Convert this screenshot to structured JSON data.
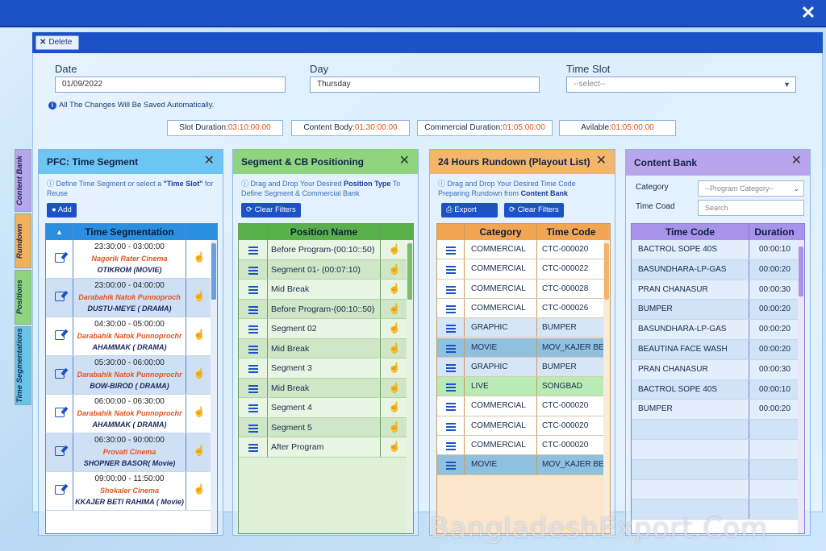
{
  "window": {
    "close_icon": "close-x-icon"
  },
  "toolbar": {
    "delete_label": "Delete"
  },
  "form": {
    "date_label": "Date",
    "date_value": "01/09/2022",
    "day_label": "Day",
    "day_value": "Thursday",
    "timeslot_label": "Time Slot",
    "timeslot_value": "--select--"
  },
  "note": "All The Changes Will Be Saved Automatically.",
  "stats": [
    {
      "label": "Slot Duration:",
      "value": "03:10:00:00"
    },
    {
      "label": "Content Body:",
      "value": "01:30:00:00"
    },
    {
      "label": "Commercial Duration:",
      "value": "01:05:00:00"
    },
    {
      "label": "Avilable:",
      "value": "01:05:00:00"
    }
  ],
  "side_tabs": [
    "Content Bank",
    "Rundown",
    "Positions",
    "Time Segmentations"
  ],
  "pfc": {
    "title": "PFC: Time Segment",
    "desc_pre": "Define Time Segment or select a ",
    "desc_bold": "\"Time Slot\"",
    "desc_post": " for Reuse",
    "add_label": "Add",
    "col_header": "Time Segmentation",
    "rows": [
      {
        "time": "23:30:00 - 03:00:00",
        "program": "Nagorik Rater Cinema",
        "content": "OTIKROM (MOVIE)"
      },
      {
        "time": "23:00:00 - 04:00:00",
        "program": "Darabahik Natok Punnoproch",
        "content": "DUSTU-MEYE ( DRAMA)"
      },
      {
        "time": "04:30:00 - 05:00:00",
        "program": "Darabahik Natok Punnoprochr",
        "content": "AHAMMAK ( DRAMA)"
      },
      {
        "time": "05:30:00 - 06:00:00",
        "program": "Darabahik Natok Punnoprochr",
        "content": "BOW-BIROD ( DRAMA)"
      },
      {
        "time": "06:00:00 - 06:30:00",
        "program": "Darabahik Natok Punnoprochr",
        "content": "AHAMMAK ( DRAMA)"
      },
      {
        "time": "06:30:00 - 90:00:00",
        "program": "Provati Cinema",
        "content": "SHOPNER BASOR( Movie)"
      },
      {
        "time": "09:00:00 - 11:50:00",
        "program": "Shokaler Cinema",
        "content": "KKAJER BETI RAHIMA ( Movie)"
      }
    ]
  },
  "segment": {
    "title": "Segment & CB Positioning",
    "desc_pre": "Drag and Drop Your Desired ",
    "desc_bold": "Position Type",
    "desc_post": " To Define Segment & Commercial Bank",
    "clear_label": "Clear Filters",
    "col_header": "Position Name",
    "rows": [
      "Before Program-(00:10::50)",
      "Segment 01- (00:07:10)",
      "Mid Break",
      "Before Program-(00:10::50)",
      "Segment 02",
      "Mid Break",
      "Segment 3",
      "Mid Break",
      "Segment 4",
      "Segment 5",
      "After Program"
    ]
  },
  "rundown": {
    "title": "24 Hours Rundown (Playout List)",
    "desc_line1": "Drag and Drop Your Desired Time Code",
    "desc_pre": "Preparing Rundown from ",
    "desc_bold": "Content Bank",
    "export_label": "Export",
    "clear_label": "Clear Filters",
    "col_category": "Category",
    "col_timecode": "Time Code",
    "rows": [
      {
        "category": "COMMERCIAL",
        "code": "CTC-000020",
        "color": "#ffffff"
      },
      {
        "category": "COMMERCIAL",
        "code": "CTC-000022",
        "color": "#ffffff"
      },
      {
        "category": "COMMERCIAL",
        "code": "CTC-000028",
        "color": "#ffffff"
      },
      {
        "category": "COMMERCIAL",
        "code": "CTC-000026",
        "color": "#ffffff"
      },
      {
        "category": "GRAPHIC",
        "code": "BUMPER",
        "color": "#d6e6f7"
      },
      {
        "category": "MOVIE",
        "code": "MOV_KAJER BET",
        "color": "#8fc1de"
      },
      {
        "category": "GRAPHIC",
        "code": "BUMPER",
        "color": "#d6e6f7"
      },
      {
        "category": "LIVE",
        "code": "SONGBAD",
        "color": "#b9ecb4"
      },
      {
        "category": "COMMERCIAL",
        "code": "CTC-000020",
        "color": "#ffffff"
      },
      {
        "category": "COMMERCIAL",
        "code": "CTC-000020",
        "color": "#ffffff"
      },
      {
        "category": "COMMERCIAL",
        "code": "CTC-000020",
        "color": "#ffffff"
      },
      {
        "category": "MOVIE",
        "code": "MOV_KAJER BET",
        "color": "#8fc1de"
      }
    ]
  },
  "bank": {
    "title": "Content Bank",
    "category_label": "Category",
    "category_value": "--Program Category--",
    "timecode_label": "Time Coad",
    "search_placeholder": "Search",
    "col_timecode": "Time Code",
    "col_duration": "Duration",
    "rows": [
      {
        "code": "BACTROL SOPE 40S",
        "duration": "00:00:10"
      },
      {
        "code": "BASUNDHARA-LP-GAS",
        "duration": "00:00:20"
      },
      {
        "code": "PRAN CHANASUR",
        "duration": "00:00:30"
      },
      {
        "code": "BUMPER",
        "duration": "00:00:20"
      },
      {
        "code": "BASUNDHARA-LP-GAS",
        "duration": "00:00:20"
      },
      {
        "code": "BEAUTINA FACE WASH",
        "duration": "00:00:20"
      },
      {
        "code": "PRAN CHANASUR",
        "duration": "00:00:30"
      },
      {
        "code": "BACTROL SOPE 40S",
        "duration": "00:00:10"
      },
      {
        "code": "BUMPER",
        "duration": "00:00:20"
      }
    ]
  },
  "watermark": "BangladeshExport.Com"
}
